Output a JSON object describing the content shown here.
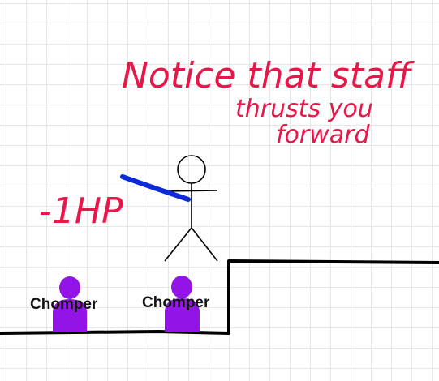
{
  "annotation": {
    "line1": "Notice that staff",
    "line2": "thrusts you",
    "line3": "forward",
    "damage": "-1HP"
  },
  "enemies": [
    {
      "label": "Chomper"
    },
    {
      "label": "Chomper"
    }
  ],
  "colors": {
    "annotation": "#e8174a",
    "staff": "#0a2bd6",
    "enemy": "#9314e6",
    "ground": "#000000",
    "grid": "#e6e6e6"
  }
}
